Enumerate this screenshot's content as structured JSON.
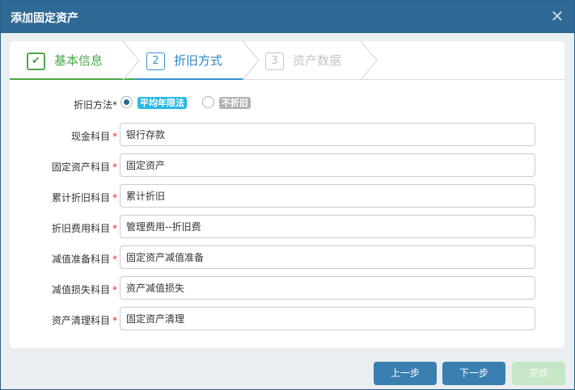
{
  "dialog": {
    "title": "添加固定资产",
    "close_glyph": "✕"
  },
  "steps": [
    {
      "number": "✔",
      "label": "基本信息",
      "state": "done"
    },
    {
      "number": "2",
      "label": "折旧方式",
      "state": "active"
    },
    {
      "number": "3",
      "label": "资产数据",
      "state": "pending"
    }
  ],
  "form": {
    "required_mark": "*",
    "depreciation_method": {
      "label": "折旧方法",
      "options": [
        {
          "label": "平均年限法",
          "selected": true
        },
        {
          "label": "不折旧",
          "selected": false
        }
      ]
    },
    "fields": [
      {
        "label": "现金科目",
        "value": "银行存款"
      },
      {
        "label": "固定资产科目",
        "value": "固定资产"
      },
      {
        "label": "累计折旧科目",
        "value": "累计折旧"
      },
      {
        "label": "折旧费用科目",
        "value": "管理费用--折旧费"
      },
      {
        "label": "减值准备科目",
        "value": "固定资产减值准备"
      },
      {
        "label": "减值损失科目",
        "value": "资产减值损失"
      },
      {
        "label": "资产清理科目",
        "value": "固定资产清理"
      }
    ]
  },
  "footer": {
    "prev_label": "上一步",
    "next_label": "下一步",
    "done_label": "完成"
  },
  "colors": {
    "titlebar": "#2e6a95",
    "step_done": "#4aa84a",
    "step_active": "#3a8fd0",
    "required": "#d9302b",
    "button": "#3a7fb0",
    "button_disabled": "#c6e7c5"
  },
  "icons": {
    "close": "close-icon",
    "step_done": "check-icon",
    "step_arrow": "chevron-right-icon"
  }
}
